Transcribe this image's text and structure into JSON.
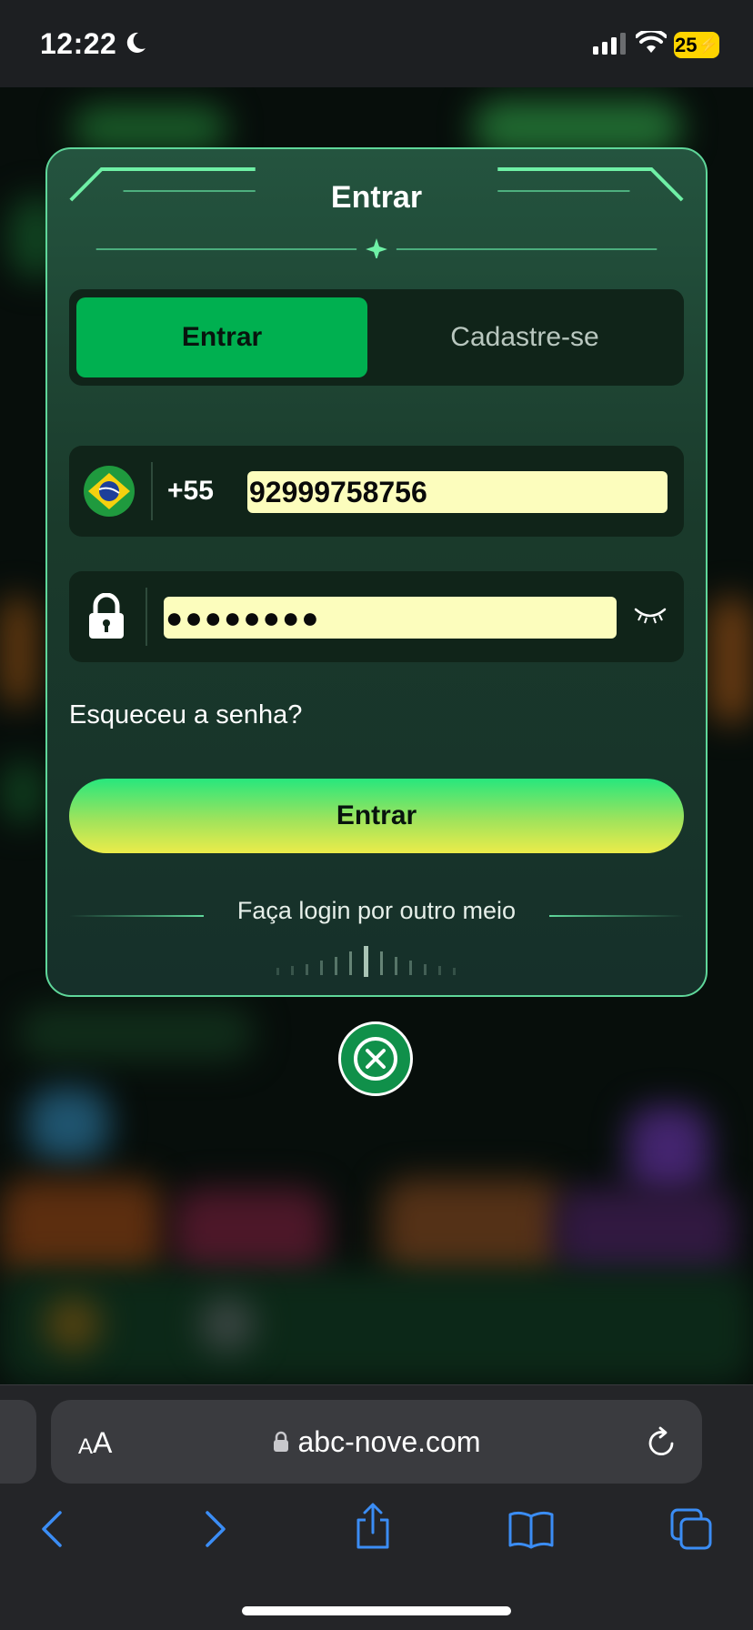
{
  "status_bar": {
    "time": "12:22",
    "battery": "25"
  },
  "modal": {
    "title": "Entrar",
    "tabs": [
      {
        "label": "Entrar",
        "active": true
      },
      {
        "label": "Cadastre-se",
        "active": false
      }
    ],
    "phone": {
      "country_code": "+55",
      "value": "92999758756",
      "flag_icon": "brazil-flag-icon"
    },
    "password": {
      "value": "●●●●●●●●",
      "toggle_icon": "eye-closed-icon"
    },
    "forgot_password": "Esqueceu a senha?",
    "submit_label": "Entrar",
    "alt_login_text": "Faça login por outro meio"
  },
  "browser": {
    "text_size_small": "A",
    "text_size_large": "A",
    "url": "abc-nove.com"
  },
  "colors": {
    "accent_green": "#00b050",
    "modal_border": "#5fd79a",
    "autofill_yellow": "#fcfdbd"
  }
}
